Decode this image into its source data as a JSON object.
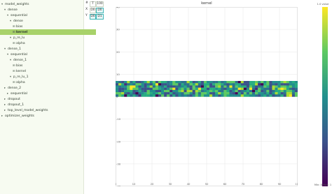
{
  "tree": [
    {
      "label": "model_weights",
      "depth": 0,
      "glyph": "▾",
      "selected": false
    },
    {
      "label": "dense",
      "depth": 1,
      "glyph": "▾",
      "selected": false
    },
    {
      "label": "sequential",
      "depth": 2,
      "glyph": "▾",
      "selected": false
    },
    {
      "label": "dense",
      "depth": 3,
      "glyph": "▾",
      "selected": false
    },
    {
      "label": "bias",
      "depth": 4,
      "glyph": "⊞",
      "selected": false
    },
    {
      "label": "kernel",
      "depth": 4,
      "glyph": "⊞",
      "selected": true
    },
    {
      "label": "p_re_lu",
      "depth": 3,
      "glyph": "▾",
      "selected": false
    },
    {
      "label": "alpha",
      "depth": 4,
      "glyph": "⊞",
      "selected": false
    },
    {
      "label": "dense_1",
      "depth": 1,
      "glyph": "▾",
      "selected": false
    },
    {
      "label": "sequential",
      "depth": 2,
      "glyph": "▾",
      "selected": false
    },
    {
      "label": "dense_1",
      "depth": 3,
      "glyph": "▾",
      "selected": false
    },
    {
      "label": "bias",
      "depth": 4,
      "glyph": "⊞",
      "selected": false
    },
    {
      "label": "kernel",
      "depth": 4,
      "glyph": "⊞",
      "selected": false
    },
    {
      "label": "p_re_lu_1",
      "depth": 3,
      "glyph": "▾",
      "selected": false
    },
    {
      "label": "alpha",
      "depth": 4,
      "glyph": "⊞",
      "selected": false
    },
    {
      "label": "dense_2",
      "depth": 1,
      "glyph": "▸",
      "selected": false
    },
    {
      "label": "sequential",
      "depth": 2,
      "glyph": "▸",
      "selected": false
    },
    {
      "label": "dropout",
      "depth": 1,
      "glyph": "▸",
      "selected": false
    },
    {
      "label": "dropout_1",
      "depth": 1,
      "glyph": "▸",
      "selected": false
    },
    {
      "label": "top_level_model_weights",
      "depth": 1,
      "glyph": "▸",
      "selected": false
    },
    {
      "label": "optimizer_weights",
      "depth": 0,
      "glyph": "▸",
      "selected": false
    }
  ],
  "controls": {
    "rows": [
      {
        "axis": "#",
        "a": "T",
        "b": "100"
      },
      {
        "axis": "X",
        "a": "D0",
        "b": "D0"
      },
      {
        "axis": "Y",
        "a": "D0",
        "b": "D1"
      }
    ]
  },
  "plot": {
    "title": "kernel",
    "colorbar_top": "1.0 value",
    "colorbar_bottom": "Min: 0 Max: 1"
  },
  "chart_data": {
    "type": "heatmap",
    "title": "kernel",
    "xlim": [
      0,
      100
    ],
    "ylim": [
      -40,
      40
    ],
    "x_ticks": [
      0,
      10,
      20,
      30,
      40,
      50,
      60,
      70,
      80,
      90,
      100
    ],
    "y_ticks": [
      40,
      30,
      20,
      10,
      0,
      -10,
      -20,
      -30,
      -40
    ],
    "grid": true,
    "colormap": "viridis",
    "matrix_rows": 7,
    "matrix_cols": 64,
    "matrix_y_range": [
      0,
      7
    ],
    "matrix_x_range": [
      0,
      100
    ],
    "colors": {
      "low": "#440154",
      "mid": "#21908d",
      "high": "#fde725"
    }
  }
}
